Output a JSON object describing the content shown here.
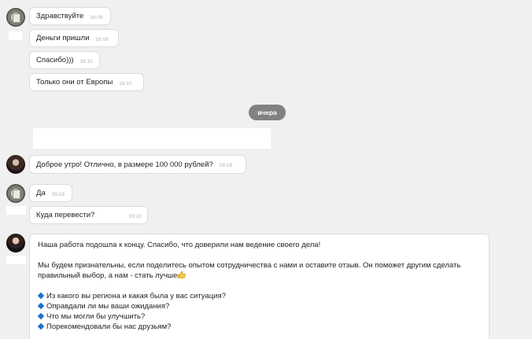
{
  "messages": [
    {
      "text": "Здравствуйте",
      "time": "16:09"
    },
    {
      "text": "Деньги пришли",
      "time": "16:09"
    },
    {
      "text": "Спасибо)))",
      "time": "16:10"
    },
    {
      "text": "Только они от Европы",
      "time": "16:10"
    },
    {
      "text": "Доброе утро! Отлично, в размере 100 000 рублей?",
      "time": "09:18"
    },
    {
      "text": "Да",
      "time": "09:19"
    },
    {
      "text": "Куда перевести?",
      "time": "09:20"
    }
  ],
  "date_separator": "вчера",
  "long_message": {
    "line1": "Наша работа подошла к концу. Спасибо, что доверили нам ведение своего дела!",
    "line2": "Мы будем признательны, если поделитесь опытом сотрудничества с нами и оставите отзыв. Он поможет другим сделать",
    "line3": "правильный выбор, а нам - стать лучше",
    "questions": [
      "Из какого вы региона и какая была у вас ситуация?",
      "Оправдали ли мы ваши ожидания?",
      "Что мы могли бы улучшить?",
      "Порекомендовали бы нас друзьям?"
    ]
  },
  "colors": {
    "background": "#f0f0f0",
    "bubble": "#ffffff",
    "date_pill": "#7f8183",
    "bullet": "#1f6fcf"
  },
  "icons": [
    "bank-avatar-icon",
    "person-avatar-icon",
    "thumbs-up-icon",
    "blue-diamond-icon"
  ]
}
